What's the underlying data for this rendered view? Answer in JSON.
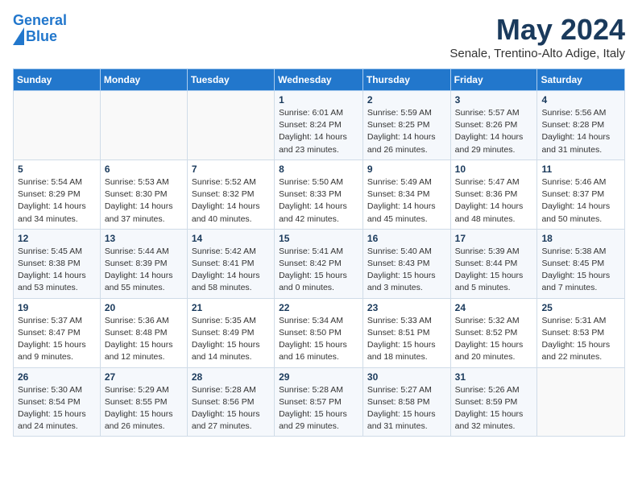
{
  "header": {
    "logo_line1": "General",
    "logo_line2": "Blue",
    "month": "May 2024",
    "location": "Senale, Trentino-Alto Adige, Italy"
  },
  "weekdays": [
    "Sunday",
    "Monday",
    "Tuesday",
    "Wednesday",
    "Thursday",
    "Friday",
    "Saturday"
  ],
  "weeks": [
    [
      {
        "day": null
      },
      {
        "day": null
      },
      {
        "day": null
      },
      {
        "day": "1",
        "sunrise": "Sunrise: 6:01 AM",
        "sunset": "Sunset: 8:24 PM",
        "daylight": "Daylight: 14 hours and 23 minutes."
      },
      {
        "day": "2",
        "sunrise": "Sunrise: 5:59 AM",
        "sunset": "Sunset: 8:25 PM",
        "daylight": "Daylight: 14 hours and 26 minutes."
      },
      {
        "day": "3",
        "sunrise": "Sunrise: 5:57 AM",
        "sunset": "Sunset: 8:26 PM",
        "daylight": "Daylight: 14 hours and 29 minutes."
      },
      {
        "day": "4",
        "sunrise": "Sunrise: 5:56 AM",
        "sunset": "Sunset: 8:28 PM",
        "daylight": "Daylight: 14 hours and 31 minutes."
      }
    ],
    [
      {
        "day": "5",
        "sunrise": "Sunrise: 5:54 AM",
        "sunset": "Sunset: 8:29 PM",
        "daylight": "Daylight: 14 hours and 34 minutes."
      },
      {
        "day": "6",
        "sunrise": "Sunrise: 5:53 AM",
        "sunset": "Sunset: 8:30 PM",
        "daylight": "Daylight: 14 hours and 37 minutes."
      },
      {
        "day": "7",
        "sunrise": "Sunrise: 5:52 AM",
        "sunset": "Sunset: 8:32 PM",
        "daylight": "Daylight: 14 hours and 40 minutes."
      },
      {
        "day": "8",
        "sunrise": "Sunrise: 5:50 AM",
        "sunset": "Sunset: 8:33 PM",
        "daylight": "Daylight: 14 hours and 42 minutes."
      },
      {
        "day": "9",
        "sunrise": "Sunrise: 5:49 AM",
        "sunset": "Sunset: 8:34 PM",
        "daylight": "Daylight: 14 hours and 45 minutes."
      },
      {
        "day": "10",
        "sunrise": "Sunrise: 5:47 AM",
        "sunset": "Sunset: 8:36 PM",
        "daylight": "Daylight: 14 hours and 48 minutes."
      },
      {
        "day": "11",
        "sunrise": "Sunrise: 5:46 AM",
        "sunset": "Sunset: 8:37 PM",
        "daylight": "Daylight: 14 hours and 50 minutes."
      }
    ],
    [
      {
        "day": "12",
        "sunrise": "Sunrise: 5:45 AM",
        "sunset": "Sunset: 8:38 PM",
        "daylight": "Daylight: 14 hours and 53 minutes."
      },
      {
        "day": "13",
        "sunrise": "Sunrise: 5:44 AM",
        "sunset": "Sunset: 8:39 PM",
        "daylight": "Daylight: 14 hours and 55 minutes."
      },
      {
        "day": "14",
        "sunrise": "Sunrise: 5:42 AM",
        "sunset": "Sunset: 8:41 PM",
        "daylight": "Daylight: 14 hours and 58 minutes."
      },
      {
        "day": "15",
        "sunrise": "Sunrise: 5:41 AM",
        "sunset": "Sunset: 8:42 PM",
        "daylight": "Daylight: 15 hours and 0 minutes."
      },
      {
        "day": "16",
        "sunrise": "Sunrise: 5:40 AM",
        "sunset": "Sunset: 8:43 PM",
        "daylight": "Daylight: 15 hours and 3 minutes."
      },
      {
        "day": "17",
        "sunrise": "Sunrise: 5:39 AM",
        "sunset": "Sunset: 8:44 PM",
        "daylight": "Daylight: 15 hours and 5 minutes."
      },
      {
        "day": "18",
        "sunrise": "Sunrise: 5:38 AM",
        "sunset": "Sunset: 8:45 PM",
        "daylight": "Daylight: 15 hours and 7 minutes."
      }
    ],
    [
      {
        "day": "19",
        "sunrise": "Sunrise: 5:37 AM",
        "sunset": "Sunset: 8:47 PM",
        "daylight": "Daylight: 15 hours and 9 minutes."
      },
      {
        "day": "20",
        "sunrise": "Sunrise: 5:36 AM",
        "sunset": "Sunset: 8:48 PM",
        "daylight": "Daylight: 15 hours and 12 minutes."
      },
      {
        "day": "21",
        "sunrise": "Sunrise: 5:35 AM",
        "sunset": "Sunset: 8:49 PM",
        "daylight": "Daylight: 15 hours and 14 minutes."
      },
      {
        "day": "22",
        "sunrise": "Sunrise: 5:34 AM",
        "sunset": "Sunset: 8:50 PM",
        "daylight": "Daylight: 15 hours and 16 minutes."
      },
      {
        "day": "23",
        "sunrise": "Sunrise: 5:33 AM",
        "sunset": "Sunset: 8:51 PM",
        "daylight": "Daylight: 15 hours and 18 minutes."
      },
      {
        "day": "24",
        "sunrise": "Sunrise: 5:32 AM",
        "sunset": "Sunset: 8:52 PM",
        "daylight": "Daylight: 15 hours and 20 minutes."
      },
      {
        "day": "25",
        "sunrise": "Sunrise: 5:31 AM",
        "sunset": "Sunset: 8:53 PM",
        "daylight": "Daylight: 15 hours and 22 minutes."
      }
    ],
    [
      {
        "day": "26",
        "sunrise": "Sunrise: 5:30 AM",
        "sunset": "Sunset: 8:54 PM",
        "daylight": "Daylight: 15 hours and 24 minutes."
      },
      {
        "day": "27",
        "sunrise": "Sunrise: 5:29 AM",
        "sunset": "Sunset: 8:55 PM",
        "daylight": "Daylight: 15 hours and 26 minutes."
      },
      {
        "day": "28",
        "sunrise": "Sunrise: 5:28 AM",
        "sunset": "Sunset: 8:56 PM",
        "daylight": "Daylight: 15 hours and 27 minutes."
      },
      {
        "day": "29",
        "sunrise": "Sunrise: 5:28 AM",
        "sunset": "Sunset: 8:57 PM",
        "daylight": "Daylight: 15 hours and 29 minutes."
      },
      {
        "day": "30",
        "sunrise": "Sunrise: 5:27 AM",
        "sunset": "Sunset: 8:58 PM",
        "daylight": "Daylight: 15 hours and 31 minutes."
      },
      {
        "day": "31",
        "sunrise": "Sunrise: 5:26 AM",
        "sunset": "Sunset: 8:59 PM",
        "daylight": "Daylight: 15 hours and 32 minutes."
      },
      {
        "day": null
      }
    ]
  ]
}
